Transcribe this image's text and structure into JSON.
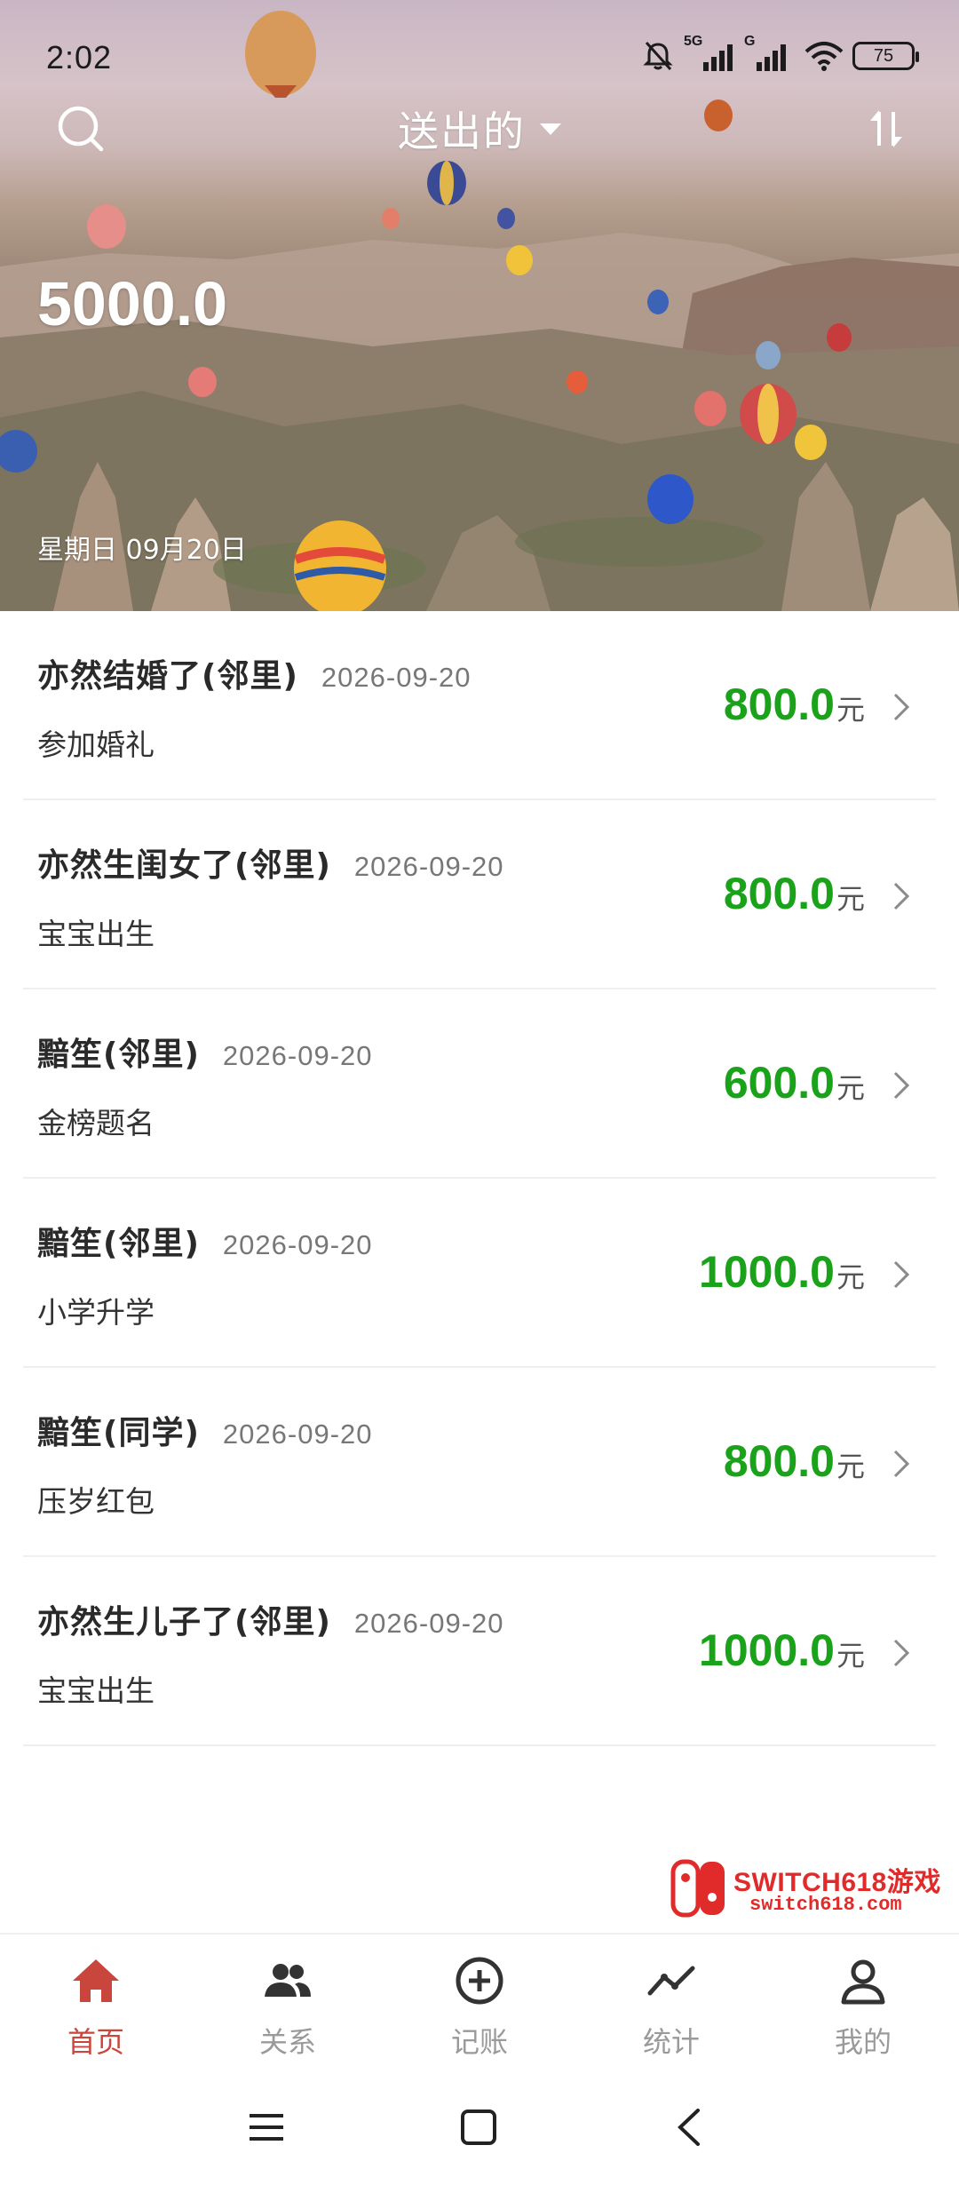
{
  "status_bar": {
    "time": "2:02",
    "network_labels": [
      "5G",
      "G"
    ],
    "battery": "75"
  },
  "header": {
    "title": "送出的",
    "total": "5000.0",
    "date": "星期日 09月20日",
    "icons": [
      "search-icon",
      "sort-icon",
      "caret-down-icon"
    ]
  },
  "records": [
    {
      "name": "亦然结婚了(邻里)",
      "date": "2026-09-20",
      "event": "参加婚礼",
      "amount": "800.0",
      "unit": "元"
    },
    {
      "name": "亦然生闺女了(邻里)",
      "date": "2026-09-20",
      "event": "宝宝出生",
      "amount": "800.0",
      "unit": "元"
    },
    {
      "name": "黯笙(邻里)",
      "date": "2026-09-20",
      "event": "金榜题名",
      "amount": "600.0",
      "unit": "元"
    },
    {
      "name": "黯笙(邻里)",
      "date": "2026-09-20",
      "event": "小学升学",
      "amount": "1000.0",
      "unit": "元"
    },
    {
      "name": "黯笙(同学)",
      "date": "2026-09-20",
      "event": "压岁红包",
      "amount": "800.0",
      "unit": "元"
    },
    {
      "name": "亦然生儿子了(邻里)",
      "date": "2026-09-20",
      "event": "宝宝出生",
      "amount": "1000.0",
      "unit": "元"
    }
  ],
  "watermark": {
    "title": "SWITCH618游戏",
    "url": "switch618.com"
  },
  "tabs": [
    {
      "label": "首页",
      "icon": "home-icon",
      "active": true
    },
    {
      "label": "关系",
      "icon": "people-icon",
      "active": false
    },
    {
      "label": "记账",
      "icon": "add-circle-icon",
      "active": false
    },
    {
      "label": "统计",
      "icon": "chart-line-icon",
      "active": false
    },
    {
      "label": "我的",
      "icon": "user-icon",
      "active": false
    }
  ],
  "colors": {
    "amount": "#1aa31a",
    "active_tab": "#c9463d",
    "inactive_tab": "#9a9a9a",
    "watermark": "#e12b2b"
  }
}
